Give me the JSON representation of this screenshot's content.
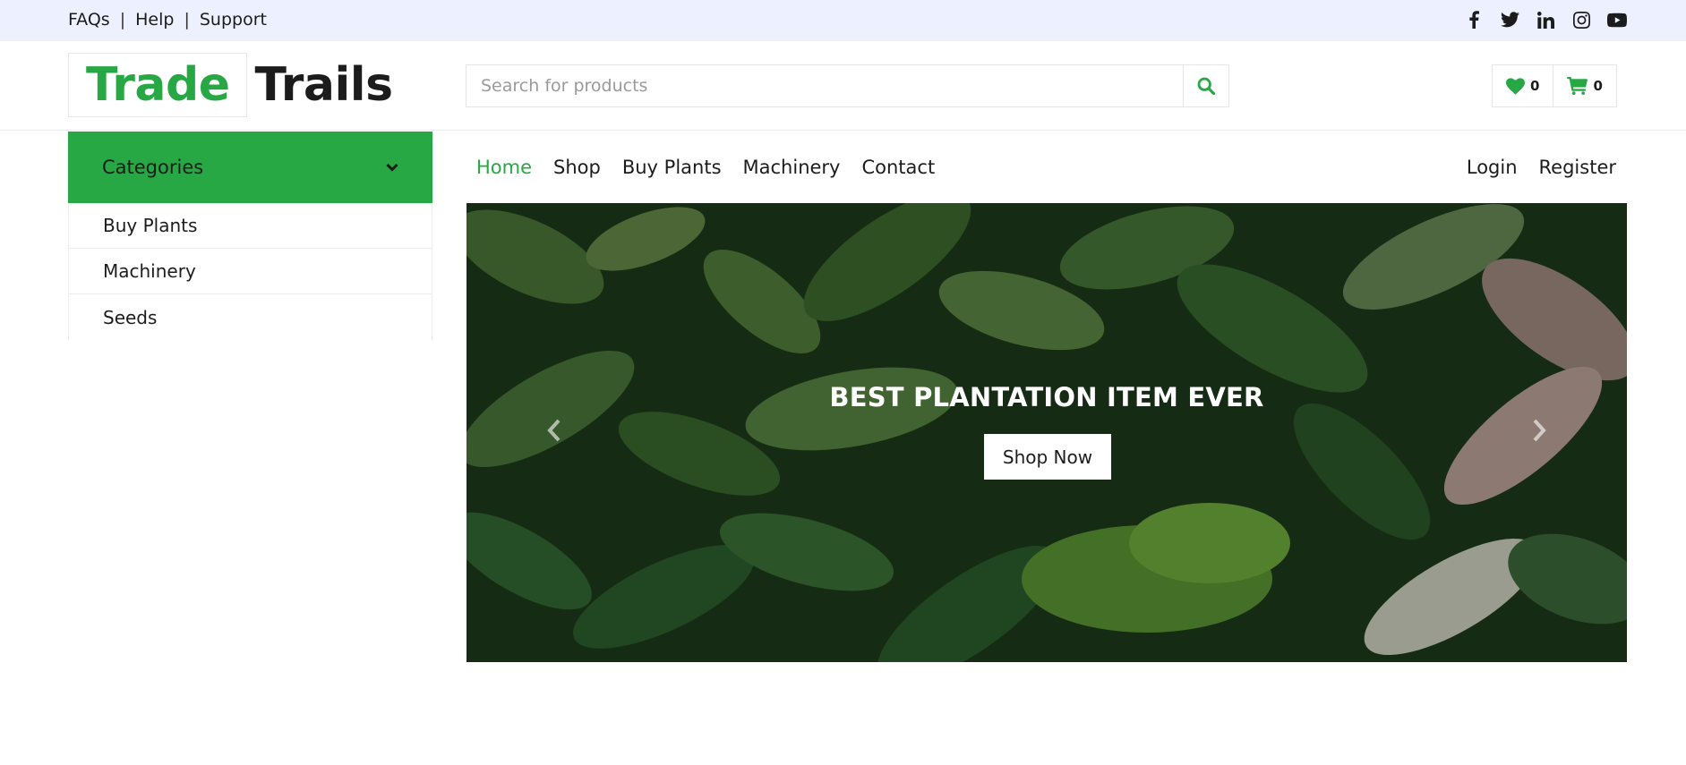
{
  "topbar": {
    "links": [
      "FAQs",
      "Help",
      "Support"
    ],
    "separator": "|",
    "social_icons": [
      "facebook-icon",
      "twitter-icon",
      "linkedin-icon",
      "instagram-icon",
      "youtube-icon"
    ]
  },
  "header": {
    "logo_first": "Trade",
    "logo_second": "Trails",
    "search_placeholder": "Search for products",
    "wishlist_count": "0",
    "cart_count": "0"
  },
  "categories": {
    "title": "Categories",
    "items": [
      "Buy Plants",
      "Machinery",
      "Seeds"
    ]
  },
  "nav": {
    "items": [
      "Home",
      "Shop",
      "Buy Plants",
      "Machinery",
      "Contact"
    ],
    "active": "Home",
    "login": "Login",
    "register": "Register"
  },
  "hero": {
    "title": "BEST PLANTATION ITEM EVER",
    "button": "Shop Now"
  },
  "colors": {
    "accent": "#28a745",
    "topbar_bg": "#edf1ff",
    "text": "#1c1c1c"
  }
}
